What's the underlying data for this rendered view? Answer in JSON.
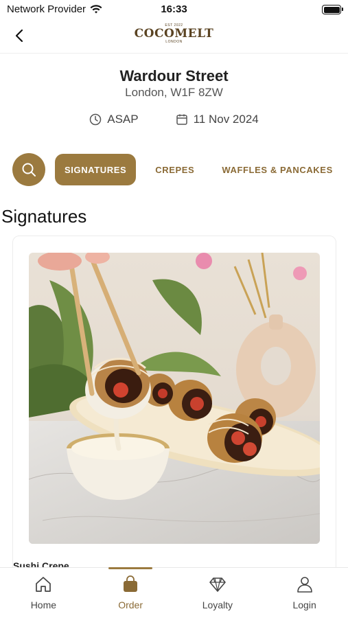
{
  "status_bar": {
    "carrier": "Network Provider",
    "time": "16:33"
  },
  "header": {
    "logo_est": "EST 2022",
    "logo_name": "COCOMELT",
    "logo_city": "LONDON"
  },
  "store": {
    "name": "Wardour Street",
    "address": "London, W1F 8ZW"
  },
  "order_meta": {
    "time_label": "ASAP",
    "date_label": "11 Nov 2024"
  },
  "categories": [
    {
      "label": "SIGNATURES",
      "active": true
    },
    {
      "label": "CREPES",
      "active": false
    },
    {
      "label": "WAFFLES & PANCAKES",
      "active": false
    }
  ],
  "section": {
    "title": "Signatures"
  },
  "products": [
    {
      "name": "Sushi Crepe"
    }
  ],
  "tab_bar": {
    "tabs": [
      {
        "label": "Home",
        "icon": "home-icon",
        "active": false
      },
      {
        "label": "Order",
        "icon": "bag-icon",
        "active": true
      },
      {
        "label": "Loyalty",
        "icon": "diamond-icon",
        "active": false
      },
      {
        "label": "Login",
        "icon": "user-icon",
        "active": false
      }
    ]
  },
  "colors": {
    "accent": "#9b7a3f",
    "accent_text": "#8a6a35",
    "brand": "#5a4322"
  }
}
